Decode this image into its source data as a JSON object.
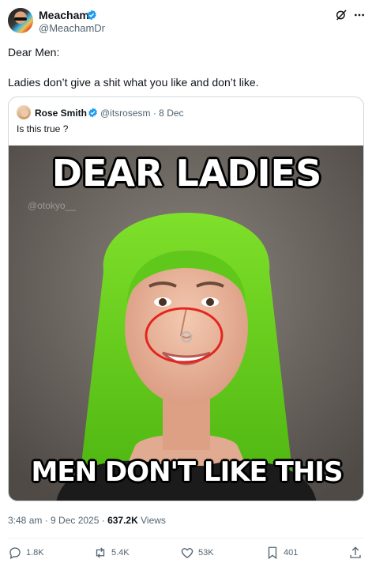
{
  "post": {
    "author_name": "Meacham",
    "author_handle": "@MeachamDr",
    "text_line1": "Dear Men:",
    "text_line2": "Ladies don’t give a shit what you like and don’t like.",
    "timestamp": "3:48 am · 9 Dec 2025 · ",
    "views_count": "637.2K",
    "views_label": " Views"
  },
  "quote": {
    "author_name": "Rose Smith",
    "meta": "@itsrosesm · 8 Dec",
    "text": "Is this true ?",
    "image": {
      "overlay_top": "DEAR LADIES",
      "overlay_bottom": "MEN DON'T LIKE THIS",
      "watermark": "@otokyo__"
    }
  },
  "actions": {
    "replies": "1.8K",
    "reposts": "5.4K",
    "likes": "53K",
    "views": "401"
  },
  "colors": {
    "verified": "#1d9bf0",
    "secondary_text": "#536471",
    "border": "#cfd9de",
    "hair": "#6fd21c",
    "circle": "#e3261f"
  }
}
